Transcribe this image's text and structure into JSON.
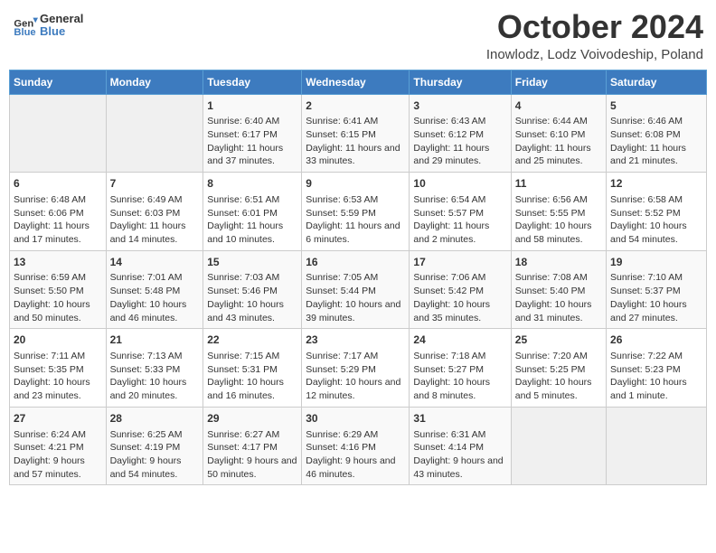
{
  "header": {
    "logo_line1": "General",
    "logo_line2": "Blue",
    "month": "October 2024",
    "location": "Inowlodz, Lodz Voivodeship, Poland"
  },
  "days_of_week": [
    "Sunday",
    "Monday",
    "Tuesday",
    "Wednesday",
    "Thursday",
    "Friday",
    "Saturday"
  ],
  "weeks": [
    [
      {
        "day": "",
        "sunrise": "",
        "sunset": "",
        "daylight": ""
      },
      {
        "day": "",
        "sunrise": "",
        "sunset": "",
        "daylight": ""
      },
      {
        "day": "1",
        "sunrise": "Sunrise: 6:40 AM",
        "sunset": "Sunset: 6:17 PM",
        "daylight": "Daylight: 11 hours and 37 minutes."
      },
      {
        "day": "2",
        "sunrise": "Sunrise: 6:41 AM",
        "sunset": "Sunset: 6:15 PM",
        "daylight": "Daylight: 11 hours and 33 minutes."
      },
      {
        "day": "3",
        "sunrise": "Sunrise: 6:43 AM",
        "sunset": "Sunset: 6:12 PM",
        "daylight": "Daylight: 11 hours and 29 minutes."
      },
      {
        "day": "4",
        "sunrise": "Sunrise: 6:44 AM",
        "sunset": "Sunset: 6:10 PM",
        "daylight": "Daylight: 11 hours and 25 minutes."
      },
      {
        "day": "5",
        "sunrise": "Sunrise: 6:46 AM",
        "sunset": "Sunset: 6:08 PM",
        "daylight": "Daylight: 11 hours and 21 minutes."
      }
    ],
    [
      {
        "day": "6",
        "sunrise": "Sunrise: 6:48 AM",
        "sunset": "Sunset: 6:06 PM",
        "daylight": "Daylight: 11 hours and 17 minutes."
      },
      {
        "day": "7",
        "sunrise": "Sunrise: 6:49 AM",
        "sunset": "Sunset: 6:03 PM",
        "daylight": "Daylight: 11 hours and 14 minutes."
      },
      {
        "day": "8",
        "sunrise": "Sunrise: 6:51 AM",
        "sunset": "Sunset: 6:01 PM",
        "daylight": "Daylight: 11 hours and 10 minutes."
      },
      {
        "day": "9",
        "sunrise": "Sunrise: 6:53 AM",
        "sunset": "Sunset: 5:59 PM",
        "daylight": "Daylight: 11 hours and 6 minutes."
      },
      {
        "day": "10",
        "sunrise": "Sunrise: 6:54 AM",
        "sunset": "Sunset: 5:57 PM",
        "daylight": "Daylight: 11 hours and 2 minutes."
      },
      {
        "day": "11",
        "sunrise": "Sunrise: 6:56 AM",
        "sunset": "Sunset: 5:55 PM",
        "daylight": "Daylight: 10 hours and 58 minutes."
      },
      {
        "day": "12",
        "sunrise": "Sunrise: 6:58 AM",
        "sunset": "Sunset: 5:52 PM",
        "daylight": "Daylight: 10 hours and 54 minutes."
      }
    ],
    [
      {
        "day": "13",
        "sunrise": "Sunrise: 6:59 AM",
        "sunset": "Sunset: 5:50 PM",
        "daylight": "Daylight: 10 hours and 50 minutes."
      },
      {
        "day": "14",
        "sunrise": "Sunrise: 7:01 AM",
        "sunset": "Sunset: 5:48 PM",
        "daylight": "Daylight: 10 hours and 46 minutes."
      },
      {
        "day": "15",
        "sunrise": "Sunrise: 7:03 AM",
        "sunset": "Sunset: 5:46 PM",
        "daylight": "Daylight: 10 hours and 43 minutes."
      },
      {
        "day": "16",
        "sunrise": "Sunrise: 7:05 AM",
        "sunset": "Sunset: 5:44 PM",
        "daylight": "Daylight: 10 hours and 39 minutes."
      },
      {
        "day": "17",
        "sunrise": "Sunrise: 7:06 AM",
        "sunset": "Sunset: 5:42 PM",
        "daylight": "Daylight: 10 hours and 35 minutes."
      },
      {
        "day": "18",
        "sunrise": "Sunrise: 7:08 AM",
        "sunset": "Sunset: 5:40 PM",
        "daylight": "Daylight: 10 hours and 31 minutes."
      },
      {
        "day": "19",
        "sunrise": "Sunrise: 7:10 AM",
        "sunset": "Sunset: 5:37 PM",
        "daylight": "Daylight: 10 hours and 27 minutes."
      }
    ],
    [
      {
        "day": "20",
        "sunrise": "Sunrise: 7:11 AM",
        "sunset": "Sunset: 5:35 PM",
        "daylight": "Daylight: 10 hours and 23 minutes."
      },
      {
        "day": "21",
        "sunrise": "Sunrise: 7:13 AM",
        "sunset": "Sunset: 5:33 PM",
        "daylight": "Daylight: 10 hours and 20 minutes."
      },
      {
        "day": "22",
        "sunrise": "Sunrise: 7:15 AM",
        "sunset": "Sunset: 5:31 PM",
        "daylight": "Daylight: 10 hours and 16 minutes."
      },
      {
        "day": "23",
        "sunrise": "Sunrise: 7:17 AM",
        "sunset": "Sunset: 5:29 PM",
        "daylight": "Daylight: 10 hours and 12 minutes."
      },
      {
        "day": "24",
        "sunrise": "Sunrise: 7:18 AM",
        "sunset": "Sunset: 5:27 PM",
        "daylight": "Daylight: 10 hours and 8 minutes."
      },
      {
        "day": "25",
        "sunrise": "Sunrise: 7:20 AM",
        "sunset": "Sunset: 5:25 PM",
        "daylight": "Daylight: 10 hours and 5 minutes."
      },
      {
        "day": "26",
        "sunrise": "Sunrise: 7:22 AM",
        "sunset": "Sunset: 5:23 PM",
        "daylight": "Daylight: 10 hours and 1 minute."
      }
    ],
    [
      {
        "day": "27",
        "sunrise": "Sunrise: 6:24 AM",
        "sunset": "Sunset: 4:21 PM",
        "daylight": "Daylight: 9 hours and 57 minutes."
      },
      {
        "day": "28",
        "sunrise": "Sunrise: 6:25 AM",
        "sunset": "Sunset: 4:19 PM",
        "daylight": "Daylight: 9 hours and 54 minutes."
      },
      {
        "day": "29",
        "sunrise": "Sunrise: 6:27 AM",
        "sunset": "Sunset: 4:17 PM",
        "daylight": "Daylight: 9 hours and 50 minutes."
      },
      {
        "day": "30",
        "sunrise": "Sunrise: 6:29 AM",
        "sunset": "Sunset: 4:16 PM",
        "daylight": "Daylight: 9 hours and 46 minutes."
      },
      {
        "day": "31",
        "sunrise": "Sunrise: 6:31 AM",
        "sunset": "Sunset: 4:14 PM",
        "daylight": "Daylight: 9 hours and 43 minutes."
      },
      {
        "day": "",
        "sunrise": "",
        "sunset": "",
        "daylight": ""
      },
      {
        "day": "",
        "sunrise": "",
        "sunset": "",
        "daylight": ""
      }
    ]
  ]
}
